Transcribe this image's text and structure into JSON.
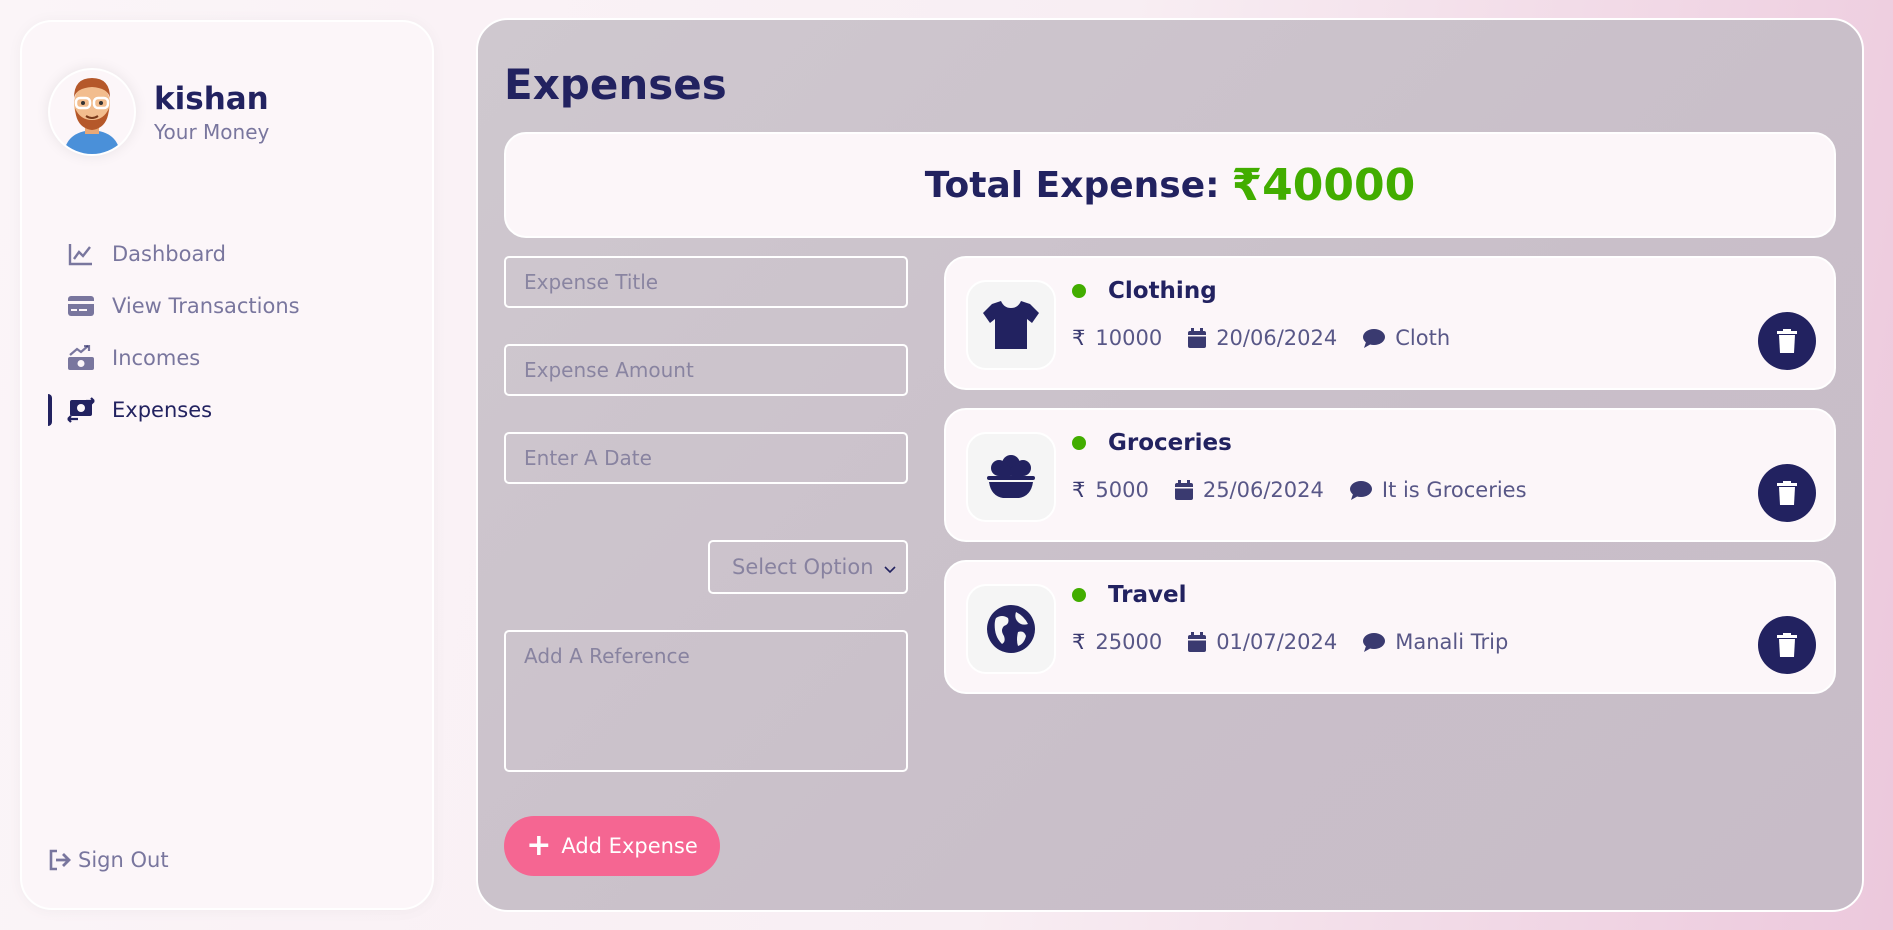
{
  "user": {
    "name": "kishan",
    "subtitle": "Your Money"
  },
  "menu": [
    {
      "label": "Dashboard",
      "icon": "chart-line-icon"
    },
    {
      "label": "View Transactions",
      "icon": "credit-card-icon"
    },
    {
      "label": "Incomes",
      "icon": "money-bill-trend-icon"
    },
    {
      "label": "Expenses",
      "icon": "money-bill-transfer-icon",
      "active": true
    }
  ],
  "signout": {
    "label": "Sign Out",
    "icon": "sign-out-icon"
  },
  "page": {
    "title": "Expenses"
  },
  "total": {
    "label": "Total Expense:",
    "value": "₹40000"
  },
  "form": {
    "title_placeholder": "Expense Title",
    "amount_placeholder": "Expense Amount",
    "date_placeholder": "Enter A Date",
    "select_value": "Select Option",
    "reference_placeholder": "Add A Reference",
    "add_label": "Add Expense"
  },
  "expenses": [
    {
      "title": "Clothing",
      "amount": "10000",
      "date": "20/06/2024",
      "note": "Cloth",
      "icon": "shirt-icon"
    },
    {
      "title": "Groceries",
      "amount": "5000",
      "date": "25/06/2024",
      "note": "It is Groceries",
      "icon": "bowl-food-icon"
    },
    {
      "title": "Travel",
      "amount": "25000",
      "date": "01/07/2024",
      "note": "Manali Trip",
      "icon": "globe-icon"
    }
  ],
  "colors": {
    "primary": "#222260",
    "accent": "#f56692",
    "green": "#42ad00"
  },
  "currency_symbol": "₹"
}
